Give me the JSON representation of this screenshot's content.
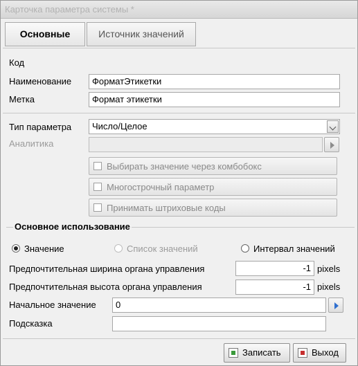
{
  "window": {
    "title": "Карточка параметра системы *"
  },
  "tabs": [
    {
      "label": "Основные"
    },
    {
      "label": "Источник значений"
    }
  ],
  "fields": {
    "code_label": "Код",
    "name_label": "Наименование",
    "name_value": "ФорматЭтикетки",
    "tag_label": "Метка",
    "tag_value": "Формат этикетки",
    "type_label": "Тип параметра",
    "type_value": "Число/Целое",
    "analytics_label": "Аналитика",
    "analytics_value": ""
  },
  "checkboxes": [
    {
      "label": "Выбирать значение через комбобокс",
      "checked": false
    },
    {
      "label": "Многострочный параметр",
      "checked": false
    },
    {
      "label": "Принимать штриховые коды",
      "checked": false
    }
  ],
  "usage": {
    "section_title": "Основное использование",
    "radios": [
      {
        "label": "Значение",
        "selected": true
      },
      {
        "label": "Список значений",
        "selected": false
      },
      {
        "label": "Интервал значений",
        "selected": false
      }
    ],
    "pref_width_label": "Предпочтительная ширина органа управления",
    "pref_width_value": "-1",
    "pref_width_unit": "pixels",
    "pref_height_label": "Предпочтительная высота органа управления",
    "pref_height_value": "-1",
    "pref_height_unit": "pixels",
    "initial_label": "Начальное значение",
    "initial_value": "0",
    "hint_label": "Подсказка",
    "hint_value": ""
  },
  "buttons": {
    "save_label": "Записать",
    "exit_label": "Выход"
  },
  "icons": {
    "save": "save-icon",
    "exit": "exit-icon"
  }
}
